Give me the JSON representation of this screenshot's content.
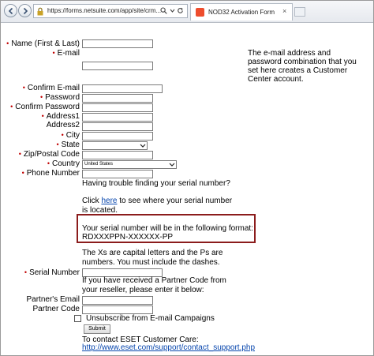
{
  "browser": {
    "url": "https://forms.netsuite.com/app/site/crm...",
    "tab_title": "NOD32 Activation Form",
    "tab_close": "×"
  },
  "form": {
    "name_label": "Name (First & Last)",
    "email_label": "E-mail",
    "confirm_email_label": "Confirm E-mail",
    "password_label": "Password",
    "confirm_password_label": "Confirm Password",
    "address1_label": "Address1",
    "address2_label": "Address2",
    "city_label": "City",
    "state_label": "State",
    "zip_label": "Zip/Postal Code",
    "country_label": "Country",
    "country_value": "United States",
    "phone_label": "Phone Number",
    "serial_label": "Serial Number",
    "partner_email_label": "Partner's Email",
    "partner_code_label": "Partner Code",
    "unsubscribe_label": "Unsubscribe from E-mail Campaigns",
    "submit_label": "Submit",
    "required_marker": "•"
  },
  "info": {
    "side_note": "The e-mail address and password combination that you set here creates a Customer Center account.",
    "trouble_text": "Having trouble finding your serial number?",
    "click_prefix": "Click ",
    "click_link": "here",
    "click_suffix": " to see where your serial number is located.",
    "format_line1": "Your serial number will be in the following format:",
    "format_line2": "RDXXXPPN-XXXXXX-PP",
    "caps_note": "The Xs are capital letters and the Ps are numbers. You must include the dashes.",
    "partner_note": "If you have received a Partner Code from your reseller, please enter it below:",
    "contact_text": "To contact ESET Customer Care:",
    "contact_link": "http://www.eset.com/support/contact_support.php"
  },
  "icons": {
    "back": "back-arrow-icon",
    "forward": "forward-arrow-icon",
    "lock": "lock-icon",
    "search": "search-icon",
    "refresh": "refresh-icon"
  }
}
